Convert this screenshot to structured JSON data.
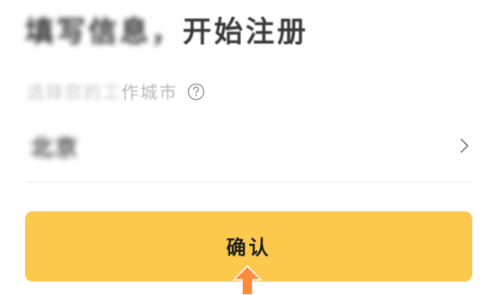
{
  "header": {
    "title_blurred": "填写信息，",
    "title_clear": "开始注册"
  },
  "city_field": {
    "label_blurred": "选择您的工",
    "label_clear": "作城市",
    "help_icon": "question-circle-icon",
    "value": "北京",
    "chevron_icon": "chevron-right-icon"
  },
  "confirm": {
    "label": "确认"
  },
  "pointer": {
    "icon": "pointer-arrow-icon",
    "color": "#ff8a3d"
  },
  "colors": {
    "accent": "#fcc94d",
    "label_gray": "#b8b8b8"
  }
}
